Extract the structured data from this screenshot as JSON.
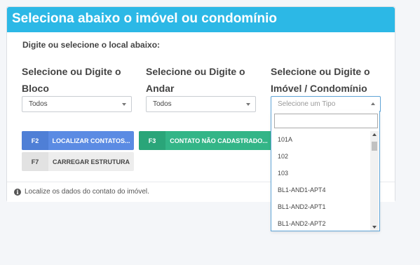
{
  "panel": {
    "title": "Seleciona abaixo o imóvel ou condomínio",
    "subtitle": "Digite ou selecione o local abaixo:"
  },
  "columns": [
    {
      "label": "Selecione ou Digite o Bloco",
      "value": "Todos"
    },
    {
      "label": "Selecione ou Digite o Andar",
      "value": "Todos"
    },
    {
      "label": "Selecione ou Digite o Imóvel / Condomínio",
      "placeholder": "Selecione um Tipo"
    }
  ],
  "buttons": {
    "localizar": {
      "key": "F2",
      "label": "LOCALIZAR CONTATOS..."
    },
    "nao_cadastrado": {
      "key": "F3",
      "label": "CONTATO NÃO CADASTRADO..."
    },
    "carregar": {
      "key": "F7",
      "label": "CARREGAR ESTRUTURA"
    }
  },
  "footer": {
    "text": "Localize os dados do contato do imóvel.",
    "icon": "info-icon"
  },
  "dropdown": {
    "search_value": "",
    "options": [
      "101A",
      "102",
      "103",
      "BL1-AND1-APT4",
      "BL1-AND2-APT1",
      "BL1-AND2-APT2"
    ]
  },
  "colors": {
    "header": "#2cb8e6",
    "blue_button": "#5b8be3",
    "green_button": "#33b587",
    "gray_button": "#ededed"
  }
}
